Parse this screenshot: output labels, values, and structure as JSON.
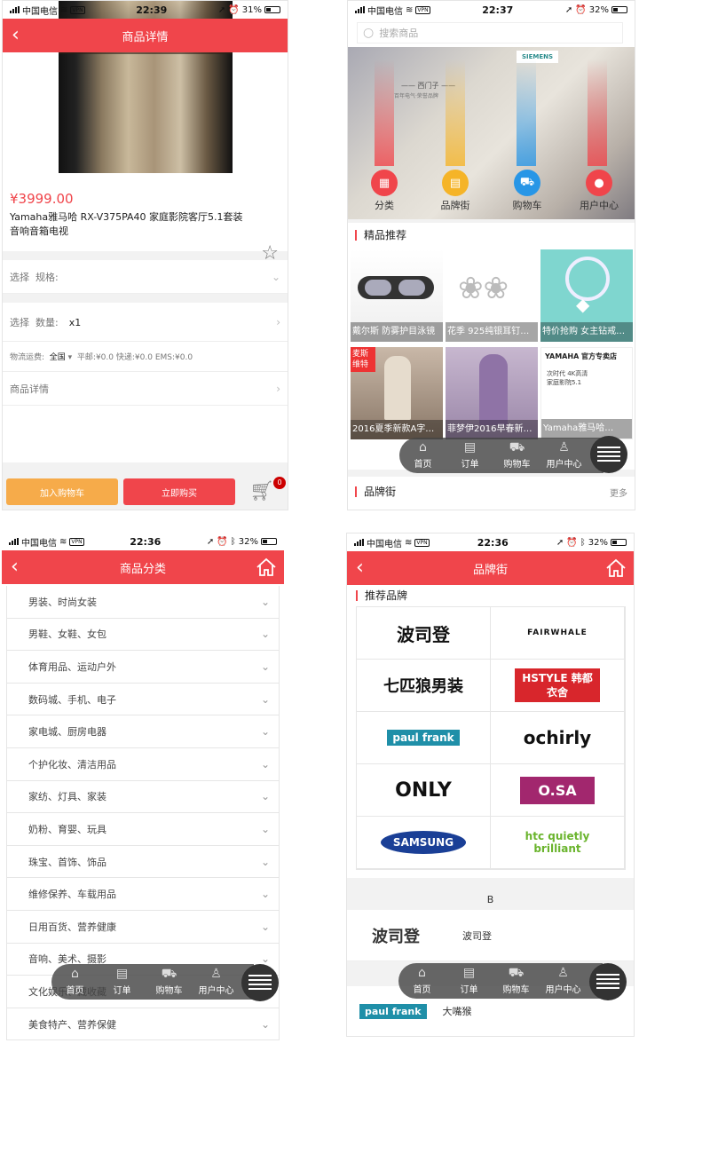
{
  "status": {
    "carrier": "中国电信",
    "vpn": "VPN"
  },
  "screens": {
    "detail": {
      "time": "22:39",
      "battery": "31%",
      "title": "商品详情",
      "price": "¥3999.00",
      "name": "Yamaha雅马哈 RX-V375PA40 家庭影院客厅5.1套装音响音箱电视",
      "spec_label": "选择",
      "spec_key": "规格:",
      "qty_label": "选择",
      "qty_key": "数量:",
      "qty_value": "x1",
      "ship_key": "物流运费:",
      "ship_region": "全国",
      "ship_pingyou": "平邮:¥0.0",
      "ship_kuaidi": "快递:¥0.0",
      "ship_ems": "EMS:¥0.0",
      "details_label": "商品详情",
      "add_cart": "加入购物车",
      "buy_now": "立即购买",
      "cart_badge": "0"
    },
    "home": {
      "time": "22:37",
      "battery": "32%",
      "search_placeholder": "搜索商品",
      "banner_brand": "SIEMENS",
      "banner_text1": "—— 西门子 ——",
      "banner_text2": "百年电气·荣誉品牌",
      "nav": [
        "分类",
        "品牌街",
        "购物车",
        "用户中心"
      ],
      "section_featured": "精品推荐",
      "tiles": [
        "戴尔斯 防雾护目泳镜",
        "花季 925纯银耳钉…",
        "特价抢购 女主钻戒…",
        "2016夏季新款A字…",
        "菲梦伊2016早春新…",
        "Yamaha雅马哈…"
      ],
      "tile_tag1": "麦斯维特",
      "tile_tag2": "YAMAHA 官方专卖店",
      "tile_tag3": "次时代 4K高清 家庭影院5.1",
      "section_brands": "品牌街",
      "more": "更多"
    },
    "categories": {
      "time": "22:36",
      "battery": "32%",
      "title": "商品分类",
      "items": [
        "男装、时尚女装",
        "男鞋、女鞋、女包",
        "体育用品、运动户外",
        "数码城、手机、电子",
        "家电城、厨房电器",
        "个护化妆、清洁用品",
        "家纺、灯具、家装",
        "奶粉、育婴、玩具",
        "珠宝、首饰、饰品",
        "维修保养、车载用品",
        "日用百货、营养健康",
        "音响、美术、摄影",
        "文化娱乐、藏收藏",
        "美食特产、营养保健"
      ]
    },
    "brands": {
      "time": "22:36",
      "battery": "32%",
      "title": "品牌街",
      "section": "推荐品牌",
      "logos": [
        "波司登",
        "FAIRWHALE",
        "七匹狼男装",
        "HSTYLE 韩都衣舍",
        "paul frank",
        "ochirly",
        "ONLY",
        "O.SA",
        "SAMSUNG",
        "htc quietly brilliant"
      ],
      "letter": "B",
      "list": [
        "波司登",
        "大嘴猴"
      ],
      "list_logo2": "paul frank"
    }
  },
  "tabbar": [
    "首页",
    "订单",
    "购物车",
    "用户中心"
  ],
  "colors": {
    "accent": "#f0454b",
    "orange": "#f6ab4a",
    "tab_bg": "#464646"
  }
}
